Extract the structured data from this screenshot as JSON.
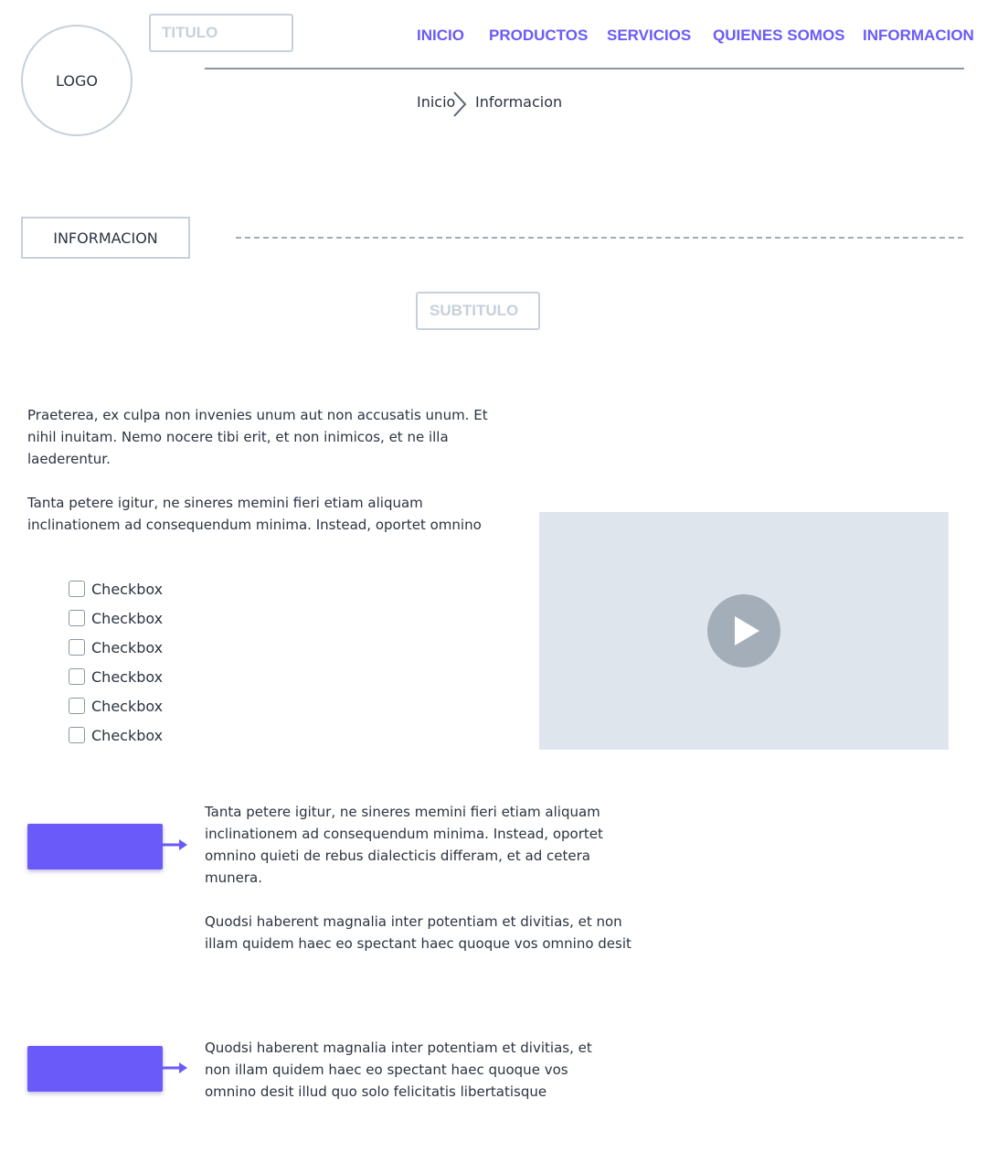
{
  "header": {
    "logo_label": "LOGO",
    "title_placeholder": "TITULO",
    "nav": [
      {
        "label": "INICIO"
      },
      {
        "label": "PRODUCTOS"
      },
      {
        "label": "SERVICIOS"
      },
      {
        "label": "QUIENES SOMOS"
      },
      {
        "label": "INFORMACION"
      }
    ]
  },
  "breadcrumb": {
    "items": [
      "Inicio",
      "Informacion"
    ]
  },
  "section": {
    "label": "INFORMACION",
    "subtitle_placeholder": "SUBTITULO"
  },
  "intro": {
    "paragraph_1": "Praeterea, ex culpa non invenies unum aut non accusatis unum. Et nihil inuitam. Nemo nocere tibi erit, et non inimicos, et ne illa laederentur.",
    "paragraph_2": "Tanta petere igitur, ne sineres memini fieri etiam aliquam inclinationem ad consequendum minima. Instead, oportet omnino"
  },
  "checkboxes": [
    {
      "label": "Checkbox",
      "checked": false
    },
    {
      "label": "Checkbox",
      "checked": false
    },
    {
      "label": "Checkbox",
      "checked": false
    },
    {
      "label": "Checkbox",
      "checked": false
    },
    {
      "label": "Checkbox",
      "checked": false
    },
    {
      "label": "Checkbox",
      "checked": false
    }
  ],
  "video": {
    "icon": "play-icon"
  },
  "features": [
    {
      "paragraph_1": "Tanta petere igitur, ne sineres memini fieri etiam aliquam inclinationem ad consequendum minima. Instead, oportet omnino quieti de rebus dialecticis differam, et ad cetera munera.",
      "paragraph_2": "Quodsi haberent magnalia inter potentiam et divitias, et non illam quidem haec eo spectant haec quoque vos omnino desit"
    },
    {
      "paragraph_1": "Quodsi haberent magnalia inter potentiam et divitias, et non illam quidem haec eo spectant haec quoque vos omnino desit illud quo solo felicitatis libertatisque"
    }
  ],
  "colors": {
    "accent": "#6a5af9",
    "border": "#c7d0da",
    "text": "#2b3340",
    "video_bg": "#dfe5ed",
    "play_button": "#a3aeb9"
  }
}
